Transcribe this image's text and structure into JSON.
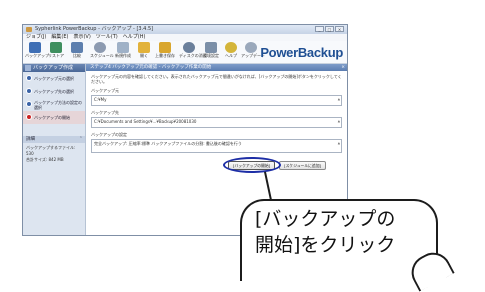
{
  "window": {
    "title": "Sypherlink PowerBackup - バックアップ - [3.4.5]",
    "min": "_",
    "max": "□",
    "close": "×"
  },
  "menu": [
    "ジョブ(J)",
    "編集(E)",
    "表示(V)",
    "ツール(T)",
    "ヘルプ(H)"
  ],
  "toolbar": {
    "items": [
      {
        "label": "バックアップ",
        "icon": "backup-icon",
        "color": "#3f6fb5"
      },
      {
        "label": "リストア",
        "icon": "restore-icon",
        "color": "#3f8f5f"
      },
      {
        "label": "比較",
        "icon": "compare-icon",
        "color": "#5d7fae"
      },
      {
        "label": "スケジュール",
        "icon": "schedule-icon",
        "color": "#8c9ab0"
      },
      {
        "label": "新規作成",
        "icon": "new-icon",
        "color": "#9fb1c7"
      },
      {
        "label": "開く",
        "icon": "open-folder-icon",
        "color": "#e2b23b"
      },
      {
        "label": "上書き保存",
        "icon": "save-icon",
        "color": "#d9a62e"
      },
      {
        "label": "ディスクの消去",
        "icon": "disk-erase-icon",
        "color": "#6a7f9b"
      },
      {
        "label": "環境設定",
        "icon": "settings-icon",
        "color": "#7b8fa8"
      },
      {
        "label": "ヘルプ",
        "icon": "help-icon",
        "color": "#d4b53a"
      },
      {
        "label": "アップデート",
        "icon": "update-icon",
        "color": "#9aa8bb"
      }
    ],
    "brand": "PowerBackup"
  },
  "sidebar": {
    "header": "バックアップ作成",
    "items": [
      {
        "label": "バックアップ元の選択",
        "active": false
      },
      {
        "label": "バックアップ先の選択",
        "active": false
      },
      {
        "label": "バックアップ方法の設定の選択",
        "active": false
      },
      {
        "label": "バックアップの開始",
        "active": true
      }
    ],
    "detail_header": "詳細",
    "detail_lines": [
      "バックアップするファイル: 530",
      "合計サイズ: 842 MB"
    ]
  },
  "panel": {
    "title": "ステップ4 バックアップ元の確認 - バックアップ作業の開始",
    "description": "バックアップ元の内容を確認してください。表示されたバックアップ元で間違いがなければ、[バックアップの開始]ボタンをクリックしてください。",
    "source_label": "バックアップ元",
    "source_value": "C:¥My",
    "dest_label": "バックアップ先",
    "dest_value": "C:¥Documents and Settings¥...¥Backup¥20081030",
    "method_label": "バックアップの設定",
    "method_value": "完全バックアップ: 圧縮率:標準 バックアップファイルの分割: 書込後の確認を行う",
    "start_button": "[バックアップの開始]",
    "cancel_button": "[スケジュールに追加]"
  },
  "callout": {
    "line1": "[バックアップの",
    "line2": "開始]をクリック"
  }
}
